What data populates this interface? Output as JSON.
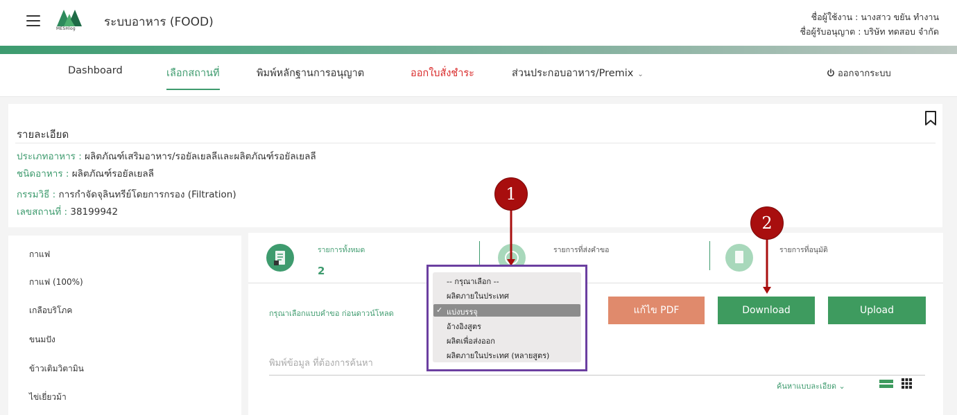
{
  "header": {
    "app_title": "ระบบอาหาร (FOOD)",
    "logo_text": "MESHlog",
    "user_line1": "ชื่อผู้ใช้งาน : นางสาว ขยัน ทำงาน",
    "user_line2": "ชื่อผู้รับอนุญาต : บริษัท ทดสอบ จำกัด"
  },
  "nav": {
    "items": [
      {
        "label": "Dashboard"
      },
      {
        "label": "เลือกสถานที่"
      },
      {
        "label": "พิมพ์หลักฐานการอนุญาต"
      },
      {
        "label": "ออกใบสั่งชำระ"
      },
      {
        "label": "ส่วนประกอบอาหาร/Premix"
      }
    ],
    "logout": "ออกจากระบบ",
    "active_color": "#3e9b6e",
    "alert_color": "#d92a2a"
  },
  "detail": {
    "title": "รายละเอียด",
    "rows": [
      {
        "label": "ประเภทอาหาร :",
        "value": " ผลิตภัณฑ์เสริมอาหาร/รอยัลเยลลีและผลิตภัณฑ์รอยัลเยลลี"
      },
      {
        "label": "ชนิดอาหาร :",
        "value": " ผลิตภัณฑ์รอยัลเยลลี"
      },
      {
        "label": "กรรมวิธี :",
        "value": " การกำจัดจุลินทรีย์โดยการกรอง (Filtration)"
      },
      {
        "label": "เลขสถานที่ :",
        "value": " 38199942"
      }
    ]
  },
  "sidebar": {
    "items": [
      {
        "label": "กาแฟ"
      },
      {
        "label": "กาแฟ (100%)"
      },
      {
        "label": "เกลือบริโภค"
      },
      {
        "label": "ขนมปัง"
      },
      {
        "label": "ข้าวเติมวิตามิน"
      },
      {
        "label": "ไข่เยี่ยวม้า"
      }
    ]
  },
  "stats": [
    {
      "label": "รายการทั้งหมด",
      "count": "2",
      "color": "#3e9b6e"
    },
    {
      "label": "รายการที่ส่งคำขอ",
      "count": "",
      "color": "#a8d8bb"
    },
    {
      "label": "รายการที่อนุมัติ",
      "count": "",
      "color": "#a8d8bb"
    }
  ],
  "form": {
    "select_label": "กรุณาเลือกแบบคำขอ ก่อนดาวน์โหลด",
    "btn_edit_pdf": "แก้ไข PDF",
    "btn_download": "Download",
    "btn_upload": "Upload",
    "search_placeholder": "พิมพ์ข้อมูล ที่ต้องการค้นหา",
    "advanced_search": "ค้นหาแบบละเอียด",
    "colors": {
      "edit_pdf": "#e08a6c",
      "download": "#3e9b5f",
      "upload": "#3e9b5f"
    }
  },
  "dropdown": {
    "options": [
      {
        "label": "-- กรุณาเลือก --"
      },
      {
        "label": "ผลิตภายในประเทศ"
      },
      {
        "label": "แบ่งบรรจุ"
      },
      {
        "label": "อ้างอิงสูตร"
      },
      {
        "label": "ผลิตเพื่อส่งออก"
      },
      {
        "label": "ผลิตภายในประเทศ (หลายสูตร)"
      }
    ],
    "selected": "แบ่งบรรจุ",
    "highlight_color": "#6b3fa0"
  },
  "callouts": [
    {
      "number": "1"
    },
    {
      "number": "2"
    }
  ]
}
